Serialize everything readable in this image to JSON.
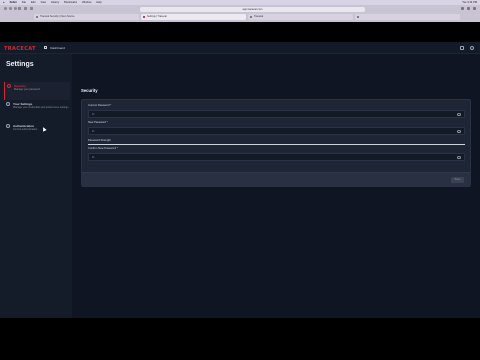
{
  "menubar": {
    "app_name": "Safari",
    "items": [
      "File",
      "Edit",
      "View",
      "History",
      "Bookmarks",
      "Window",
      "Help"
    ],
    "clock": "Tue 3:14 PM"
  },
  "browser": {
    "address": "app.tracecat.com",
    "tabs": [
      {
        "title": "Tracecat Security | Open Source"
      },
      {
        "title": "Settings | Tracecat"
      },
      {
        "title": "Tracecat"
      },
      {
        "title": ""
      }
    ]
  },
  "header": {
    "logo": "TRACECAT",
    "dashboard_label": "Dashboard"
  },
  "sidebar": {
    "title": "Settings",
    "items": [
      {
        "label": "Security",
        "desc": "Manage your password"
      },
      {
        "label": "Your Settings",
        "desc": "Manage your credentials and preferences settings"
      },
      {
        "label": "Authentication",
        "desc": "Control authentication"
      }
    ]
  },
  "main": {
    "title": "Security",
    "fields": [
      {
        "label": "Current Password *",
        "value": "••"
      },
      {
        "label": "New Password *",
        "value": "••"
      },
      {
        "label": "Password Strength",
        "value": ""
      },
      {
        "label": "Confirm New Password *",
        "value": "••"
      }
    ],
    "save_label": "Save"
  },
  "colors": {
    "accent": "#d12b36",
    "background": "#0f1522",
    "card": "#1e2635"
  }
}
